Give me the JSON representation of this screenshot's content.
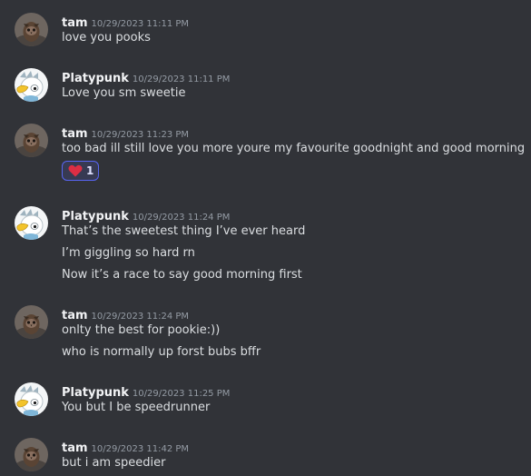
{
  "messages": [
    {
      "username": "tam",
      "timestamp": "10/29/2023 11:11 PM",
      "lines": [
        "love you pooks"
      ]
    },
    {
      "username": "Platypunk",
      "timestamp": "10/29/2023 11:11 PM",
      "lines": [
        "Love you sm sweetie"
      ]
    },
    {
      "username": "tam",
      "timestamp": "10/29/2023 11:23 PM",
      "lines": [
        "too bad ill still love you more youre my favourite goodnight and good morning"
      ],
      "reaction": {
        "emoji": "heart-icon",
        "count": "1",
        "color": "#dd2e44"
      }
    },
    {
      "username": "Platypunk",
      "timestamp": "10/29/2023 11:24 PM",
      "lines": [
        "That’s the sweetest thing I’ve ever heard",
        "I’m giggling so hard rn",
        "Now it’s a race to say good morning first"
      ]
    },
    {
      "username": "tam",
      "timestamp": "10/29/2023 11:24 PM",
      "lines": [
        "onlty the best for pookie:))",
        "who is normally up forst bubs bffr"
      ]
    },
    {
      "username": "Platypunk",
      "timestamp": "10/29/2023 11:25 PM",
      "lines": [
        "You but I be speedrunner"
      ]
    },
    {
      "username": "tam",
      "timestamp": "10/29/2023 11:42 PM",
      "lines": [
        "but i am speedier"
      ]
    }
  ],
  "colors": {
    "background": "#313338",
    "username": "#f2f3f5",
    "timestamp": "#949ba4",
    "message_text": "#dbdee1",
    "reaction_border": "#5865f2"
  }
}
